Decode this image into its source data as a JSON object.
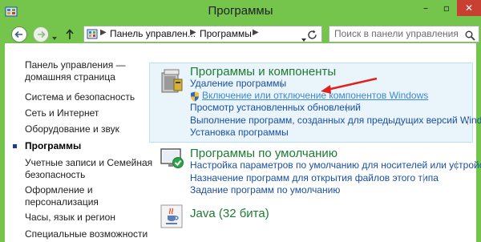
{
  "window": {
    "title": "Программы",
    "minimize_label": "–",
    "maximize_label": "▫",
    "close_label": "✕"
  },
  "address_bar": {
    "crumbs": [
      "Панель управлен...",
      "Программы"
    ]
  },
  "search": {
    "placeholder": "Поиск в панели управления"
  },
  "sidebar": {
    "items": [
      {
        "label": "Панель управления —"
      },
      {
        "label": "домашняя страница"
      },
      {
        "label": "Система и безопасность"
      },
      {
        "label": "Сеть и Интернет"
      },
      {
        "label": "Оборудование и звук"
      },
      {
        "label": "Программы"
      },
      {
        "label": "Учетные записи и Семейная"
      },
      {
        "label": "безопасность"
      },
      {
        "label": "Оформление и"
      },
      {
        "label": "персонализация"
      },
      {
        "label": "Часы, язык и регион"
      },
      {
        "label": "Специальные возможности"
      }
    ]
  },
  "sections": [
    {
      "title": "Программы и компоненты",
      "links": [
        "Удаление программы",
        "Включение или отключение компонентов Windows",
        "Просмотр установленных обновлений",
        "Выполнение программ, созданных для предыдущих версий Windows",
        "Установка программы"
      ]
    },
    {
      "title": "Программы по умолчанию",
      "links": [
        "Настройка параметров по умолчанию для носителей или устройств",
        "Назначение программ для открытия файлов этого типа",
        "Задание программ по умолчанию"
      ]
    },
    {
      "title": "Java (32 бита)",
      "links": []
    }
  ],
  "colors": {
    "accent_frame": "#75c44b",
    "section_title": "#1e7a35",
    "link": "#1a4fa3",
    "annotation_arrow": "#e0221b"
  }
}
